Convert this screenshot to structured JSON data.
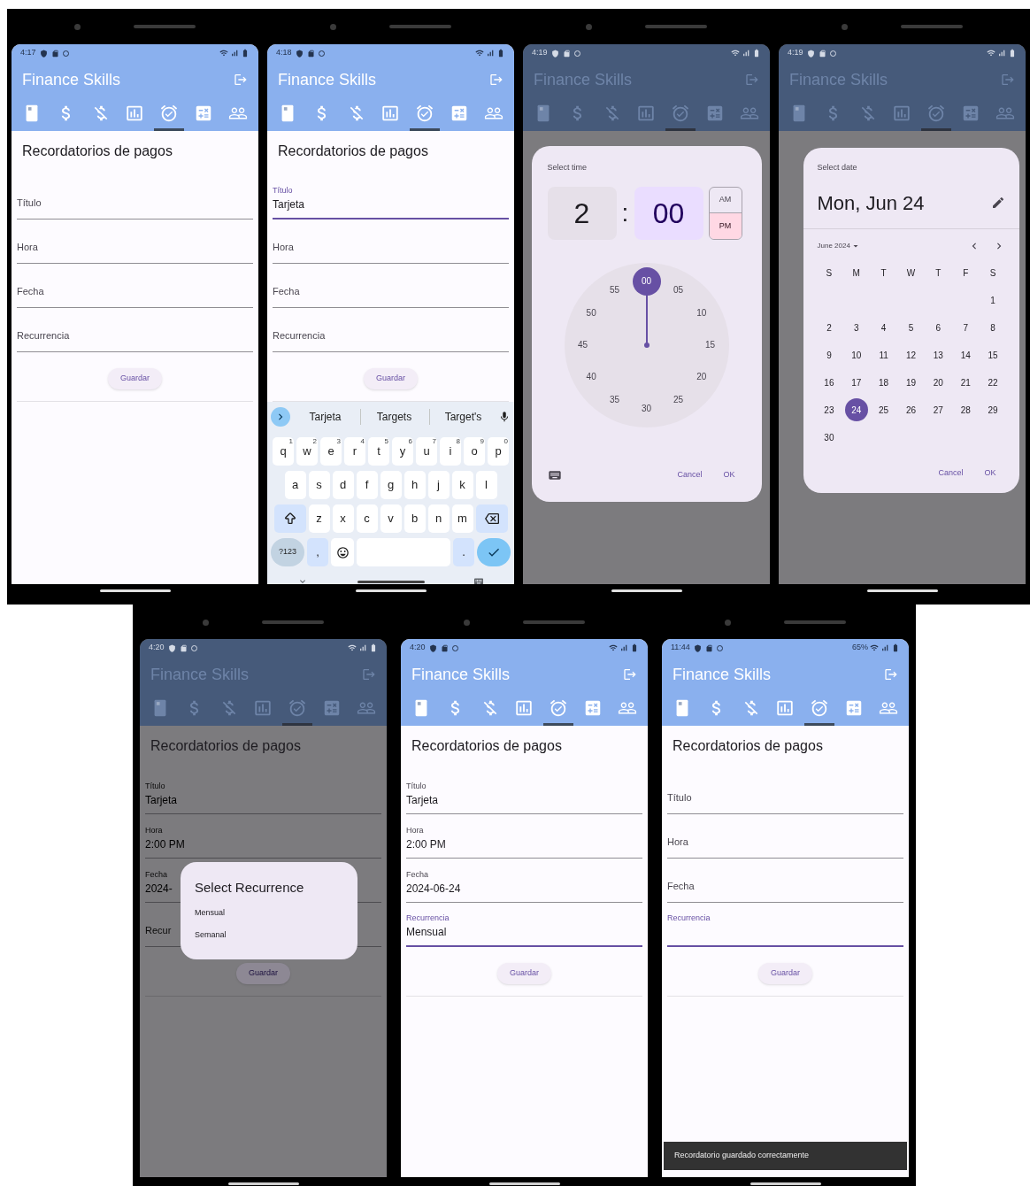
{
  "phones": [
    {
      "status": {
        "time": "4:17"
      },
      "app_title": "Finance Skills",
      "tabs": [
        {
          "kind": "card",
          "selected": false
        },
        {
          "kind": "dollar",
          "selected": false
        },
        {
          "kind": "dollar-off",
          "selected": false
        },
        {
          "kind": "chart",
          "selected": false
        },
        {
          "kind": "alarm",
          "selected": true
        },
        {
          "kind": "calculator",
          "selected": false
        },
        {
          "kind": "people",
          "selected": false
        }
      ],
      "page_title": "Recordatorios de pagos",
      "fields": [
        {
          "label": "Título",
          "focused": false
        },
        {
          "label": "Hora",
          "focused": false
        },
        {
          "label": "Fecha",
          "focused": false
        },
        {
          "label": "Recurrencia",
          "focused": false
        }
      ],
      "save_button": "Guardar"
    },
    {
      "status": {
        "time": "4:18"
      },
      "app_title": "Finance Skills",
      "tabs": [
        {
          "kind": "card",
          "selected": false
        },
        {
          "kind": "dollar",
          "selected": false
        },
        {
          "kind": "dollar-off",
          "selected": false
        },
        {
          "kind": "chart",
          "selected": false
        },
        {
          "kind": "alarm",
          "selected": true
        },
        {
          "kind": "calculator",
          "selected": false
        },
        {
          "kind": "people",
          "selected": false
        }
      ],
      "page_title": "Recordatorios de pagos",
      "fields": [
        {
          "label": "Título",
          "value": "Tarjeta",
          "focused": true
        },
        {
          "label": "Hora",
          "focused": false
        },
        {
          "label": "Fecha",
          "focused": false
        },
        {
          "label": "Recurrencia",
          "focused": false
        }
      ],
      "save_button": "Guardar",
      "keyboard": {
        "suggestions": [
          "Tarjeta",
          "Targets",
          "Target's"
        ],
        "key_lines": [
          [
            {
              "kind": "letter",
              "label": "q",
              "hint": "1"
            },
            {
              "kind": "letter",
              "label": "w",
              "hint": "2"
            },
            {
              "kind": "letter",
              "label": "e",
              "hint": "3"
            },
            {
              "kind": "letter",
              "label": "r",
              "hint": "4"
            },
            {
              "kind": "letter",
              "label": "t",
              "hint": "5"
            },
            {
              "kind": "letter",
              "label": "y",
              "hint": "6"
            },
            {
              "kind": "letter",
              "label": "u",
              "hint": "7"
            },
            {
              "kind": "letter",
              "label": "i",
              "hint": "8"
            },
            {
              "kind": "letter",
              "label": "o",
              "hint": "9"
            },
            {
              "kind": "letter",
              "label": "p",
              "hint": "0"
            }
          ],
          [
            {
              "kind": "letter",
              "label": "a"
            },
            {
              "kind": "letter",
              "label": "s"
            },
            {
              "kind": "letter",
              "label": "d"
            },
            {
              "kind": "letter",
              "label": "f"
            },
            {
              "kind": "letter",
              "label": "g"
            },
            {
              "kind": "letter",
              "label": "h"
            },
            {
              "kind": "letter",
              "label": "j"
            },
            {
              "kind": "letter",
              "label": "k"
            },
            {
              "kind": "letter",
              "label": "l"
            }
          ],
          [
            {
              "kind": "shift"
            },
            {
              "kind": "letter",
              "label": "z"
            },
            {
              "kind": "letter",
              "label": "x"
            },
            {
              "kind": "letter",
              "label": "c"
            },
            {
              "kind": "letter",
              "label": "v"
            },
            {
              "kind": "letter",
              "label": "b"
            },
            {
              "kind": "letter",
              "label": "n"
            },
            {
              "kind": "letter",
              "label": "m"
            },
            {
              "kind": "backspace"
            }
          ],
          [
            {
              "kind": "symbols",
              "label": "?123"
            },
            {
              "kind": "punct",
              "label": ","
            },
            {
              "kind": "emoji"
            },
            {
              "kind": "space"
            },
            {
              "kind": "punct",
              "label": "."
            },
            {
              "kind": "enter"
            }
          ]
        ]
      }
    },
    {
      "status": {
        "time": "4:19"
      },
      "app_title": "Finance Skills",
      "tabs": [
        {
          "kind": "card",
          "selected": false
        },
        {
          "kind": "dollar",
          "selected": false
        },
        {
          "kind": "dollar-off",
          "selected": false
        },
        {
          "kind": "chart",
          "selected": false
        },
        {
          "kind": "alarm",
          "selected": true
        },
        {
          "kind": "calculator",
          "selected": false
        },
        {
          "kind": "people",
          "selected": false
        }
      ],
      "dialog": {
        "kind": "time",
        "title": "Select time",
        "separator": ":",
        "segments": [
          {
            "text": "2",
            "selected": false
          },
          {
            "text": "00",
            "selected": true
          }
        ],
        "periods": [
          {
            "label": "AM",
            "selected": false
          },
          {
            "label": "PM",
            "selected": true
          }
        ],
        "dial": [
          {
            "label": "00",
            "selected": true
          },
          {
            "label": "05",
            "selected": false
          },
          {
            "label": "10",
            "selected": false
          },
          {
            "label": "15",
            "selected": false
          },
          {
            "label": "20",
            "selected": false
          },
          {
            "label": "25",
            "selected": false
          },
          {
            "label": "30",
            "selected": false
          },
          {
            "label": "35",
            "selected": false
          },
          {
            "label": "40",
            "selected": false
          },
          {
            "label": "45",
            "selected": false
          },
          {
            "label": "50",
            "selected": false
          },
          {
            "label": "55",
            "selected": false
          }
        ],
        "actions": [
          "Cancel",
          "OK"
        ]
      }
    },
    {
      "status": {
        "time": "4:19"
      },
      "app_title": "Finance Skills",
      "tabs": [
        {
          "kind": "card",
          "selected": false
        },
        {
          "kind": "dollar",
          "selected": false
        },
        {
          "kind": "dollar-off",
          "selected": false
        },
        {
          "kind": "chart",
          "selected": false
        },
        {
          "kind": "alarm",
          "selected": true
        },
        {
          "kind": "calculator",
          "selected": false
        },
        {
          "kind": "people",
          "selected": false
        }
      ],
      "dialog": {
        "kind": "date",
        "title": "Select date",
        "headline": "Mon, Jun 24",
        "month": "June 2024",
        "weekdays": [
          "S",
          "M",
          "T",
          "W",
          "T",
          "F",
          "S"
        ],
        "weeks": [
          [
            {
              "day": "1",
              "selected": false
            }
          ],
          [
            {
              "day": "2",
              "selected": false
            },
            {
              "day": "3",
              "selected": false
            },
            {
              "day": "4",
              "selected": false
            },
            {
              "day": "5",
              "selected": false
            },
            {
              "day": "6",
              "selected": false
            },
            {
              "day": "7",
              "selected": false
            },
            {
              "day": "8",
              "selected": false
            }
          ],
          [
            {
              "day": "9",
              "selected": false
            },
            {
              "day": "10",
              "selected": false
            },
            {
              "day": "11",
              "selected": false
            },
            {
              "day": "12",
              "selected": false
            },
            {
              "day": "13",
              "selected": false
            },
            {
              "day": "14",
              "selected": false
            },
            {
              "day": "15",
              "selected": false
            }
          ],
          [
            {
              "day": "16",
              "selected": false
            },
            {
              "day": "17",
              "selected": false
            },
            {
              "day": "18",
              "selected": false
            },
            {
              "day": "19",
              "selected": false
            },
            {
              "day": "20",
              "selected": false
            },
            {
              "day": "21",
              "selected": false
            },
            {
              "day": "22",
              "selected": false
            }
          ],
          [
            {
              "day": "23",
              "selected": false
            },
            {
              "day": "24",
              "selected": true
            },
            {
              "day": "25",
              "selected": false
            },
            {
              "day": "26",
              "selected": false
            },
            {
              "day": "27",
              "selected": false
            },
            {
              "day": "28",
              "selected": false
            },
            {
              "day": "29",
              "selected": false
            }
          ],
          [
            {
              "day": "30",
              "selected": false
            }
          ]
        ],
        "actions": [
          "Cancel",
          "OK"
        ]
      }
    },
    {
      "status": {
        "time": "4:20"
      },
      "app_title": "Finance Skills",
      "tabs": [
        {
          "kind": "card",
          "selected": false
        },
        {
          "kind": "dollar",
          "selected": false
        },
        {
          "kind": "dollar-off",
          "selected": false
        },
        {
          "kind": "chart",
          "selected": false
        },
        {
          "kind": "alarm",
          "selected": true
        },
        {
          "kind": "calculator",
          "selected": false
        },
        {
          "kind": "people",
          "selected": false
        }
      ],
      "page_title": "Recordatorios de pagos",
      "fields": [
        {
          "label": "Título",
          "value": "Tarjeta",
          "focused": false
        },
        {
          "label": "Hora",
          "value": "2:00 PM",
          "focused": false
        },
        {
          "label": "Fecha",
          "value": "2024-",
          "focused": false
        },
        {
          "label": "Recur",
          "focused": false
        }
      ],
      "save_button": "Guardar",
      "dialog": {
        "kind": "list",
        "title": "Select Recurrence",
        "options": [
          "Mensual",
          "Semanal"
        ]
      }
    },
    {
      "status": {
        "time": "4:20"
      },
      "app_title": "Finance Skills",
      "tabs": [
        {
          "kind": "card",
          "selected": false
        },
        {
          "kind": "dollar",
          "selected": false
        },
        {
          "kind": "dollar-off",
          "selected": false
        },
        {
          "kind": "chart",
          "selected": false
        },
        {
          "kind": "alarm",
          "selected": true
        },
        {
          "kind": "calculator",
          "selected": false
        },
        {
          "kind": "people",
          "selected": false
        }
      ],
      "page_title": "Recordatorios de pagos",
      "fields": [
        {
          "label": "Título",
          "value": "Tarjeta",
          "focused": false
        },
        {
          "label": "Hora",
          "value": "2:00 PM",
          "focused": false
        },
        {
          "label": "Fecha",
          "value": "2024-06-24",
          "focused": false
        },
        {
          "label": "Recurrencia",
          "value": "Mensual",
          "focused": true
        }
      ],
      "save_button": "Guardar"
    },
    {
      "status": {
        "time": "11:44",
        "battery": "65%"
      },
      "app_title": "Finance Skills",
      "tabs": [
        {
          "kind": "card",
          "selected": false
        },
        {
          "kind": "dollar",
          "selected": false
        },
        {
          "kind": "dollar-off",
          "selected": false
        },
        {
          "kind": "chart",
          "selected": false
        },
        {
          "kind": "alarm",
          "selected": true
        },
        {
          "kind": "calculator",
          "selected": false
        },
        {
          "kind": "people",
          "selected": false
        }
      ],
      "page_title": "Recordatorios de pagos",
      "fields": [
        {
          "label": "Título",
          "focused": false
        },
        {
          "label": "Hora",
          "focused": false
        },
        {
          "label": "Fecha",
          "focused": false
        },
        {
          "label": "Recurrencia",
          "focused": true
        }
      ],
      "save_button": "Guardar",
      "snackbar": "Recordatorio guardado correctamente"
    }
  ]
}
